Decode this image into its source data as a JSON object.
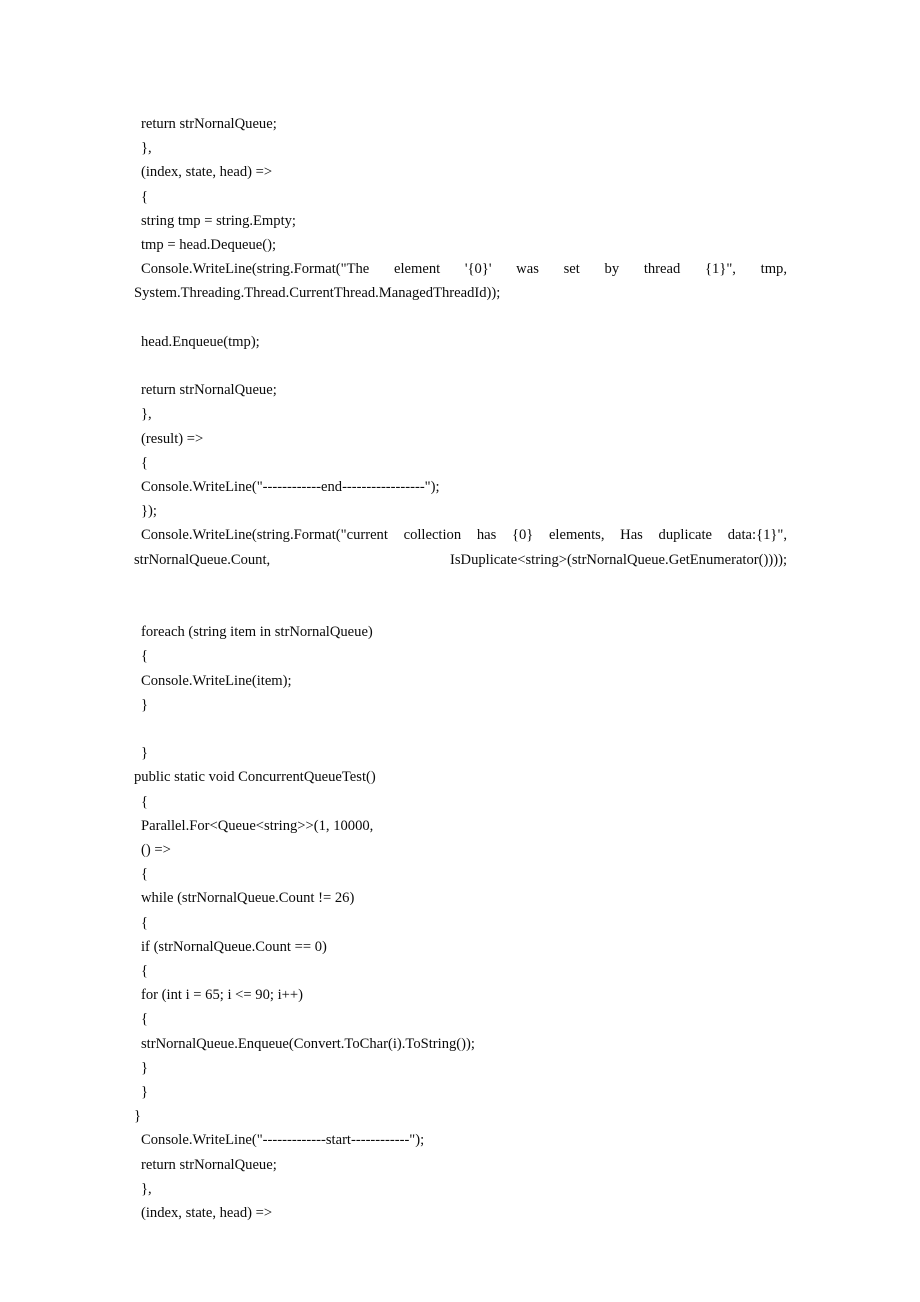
{
  "document": {
    "kind": "code-listing-page",
    "language": "C#",
    "background_color": "#ffffff",
    "text_color": "#0a0a0a",
    "lines": [
      {
        "id": "l1",
        "indent": 1,
        "text": "return strNornalQueue;"
      },
      {
        "id": "l2",
        "indent": 1,
        "text": "},"
      },
      {
        "id": "l3",
        "indent": 1,
        "text": "(index, state, head) =>"
      },
      {
        "id": "l4",
        "indent": 1,
        "text": "{"
      },
      {
        "id": "l5",
        "indent": 1,
        "text": "string tmp = string.Empty;"
      },
      {
        "id": "l6",
        "indent": 1,
        "text": "tmp = head.Dequeue();"
      },
      {
        "id": "l7",
        "indent": 1,
        "wrapped": true,
        "justify": true,
        "text": "Console.WriteLine(string.Format(\"The element '{0}' was set by thread {1}\", tmp, System.Threading.Thread.CurrentThread.ManagedThreadId));"
      },
      {
        "id": "l8",
        "indent": 1,
        "text": "head.Enqueue(tmp);"
      },
      {
        "id": "l9",
        "indent": 1,
        "blank": true,
        "text": ""
      },
      {
        "id": "l10",
        "indent": 1,
        "text": "return strNornalQueue;"
      },
      {
        "id": "l11",
        "indent": 1,
        "text": "},"
      },
      {
        "id": "l12",
        "indent": 1,
        "text": "(result) =>"
      },
      {
        "id": "l13",
        "indent": 1,
        "text": "{"
      },
      {
        "id": "l14",
        "indent": 1,
        "text": "Console.WriteLine(\"------------end-----------------\");"
      },
      {
        "id": "l15",
        "indent": 1,
        "text": "});"
      },
      {
        "id": "l16",
        "indent": 1,
        "wrapped": true,
        "justify": true,
        "text": "Console.WriteLine(string.Format(\"current collection has {0} elements, Has duplicate data:{1}\", strNornalQueue.Count, IsDuplicate<string>(strNornalQueue.GetEnumerator())));"
      },
      {
        "id": "l17",
        "indent": 1,
        "blank": true,
        "text": ""
      },
      {
        "id": "l18",
        "indent": 1,
        "text": "foreach (string item in strNornalQueue)"
      },
      {
        "id": "l19",
        "indent": 1,
        "text": "{"
      },
      {
        "id": "l20",
        "indent": 1,
        "text": "Console.WriteLine(item);"
      },
      {
        "id": "l21",
        "indent": 1,
        "text": "}"
      },
      {
        "id": "l22",
        "indent": 1,
        "blank": true,
        "text": ""
      },
      {
        "id": "l23",
        "indent": 1,
        "text": "}"
      },
      {
        "id": "l24",
        "indent": 0,
        "text": "public static void ConcurrentQueueTest()"
      },
      {
        "id": "l25",
        "indent": 1,
        "text": "{"
      },
      {
        "id": "l26",
        "indent": 1,
        "text": "Parallel.For<Queue<string>>(1, 10000,"
      },
      {
        "id": "l27",
        "indent": 1,
        "text": "() =>"
      },
      {
        "id": "l28",
        "indent": 1,
        "text": "{"
      },
      {
        "id": "l29",
        "indent": 1,
        "text": "while (strNornalQueue.Count != 26)"
      },
      {
        "id": "l30",
        "indent": 1,
        "text": "{"
      },
      {
        "id": "l31",
        "indent": 1,
        "text": "if (strNornalQueue.Count == 0)"
      },
      {
        "id": "l32",
        "indent": 1,
        "text": "{"
      },
      {
        "id": "l33",
        "indent": 1,
        "text": "for (int i = 65; i <= 90; i++)"
      },
      {
        "id": "l34",
        "indent": 1,
        "text": "{"
      },
      {
        "id": "l35",
        "indent": 1,
        "text": "strNornalQueue.Enqueue(Convert.ToChar(i).ToString());"
      },
      {
        "id": "l36",
        "indent": 1,
        "text": "}"
      },
      {
        "id": "l37",
        "indent": 1,
        "text": "}"
      },
      {
        "id": "l38",
        "indent": 0,
        "text": "}"
      },
      {
        "id": "l39",
        "indent": 1,
        "text": "Console.WriteLine(\"-------------start------------\");"
      },
      {
        "id": "l40",
        "indent": 1,
        "text": "return strNornalQueue;"
      },
      {
        "id": "l41",
        "indent": 1,
        "text": "},"
      },
      {
        "id": "l42",
        "indent": 1,
        "text": "(index, state, head) =>"
      }
    ]
  }
}
